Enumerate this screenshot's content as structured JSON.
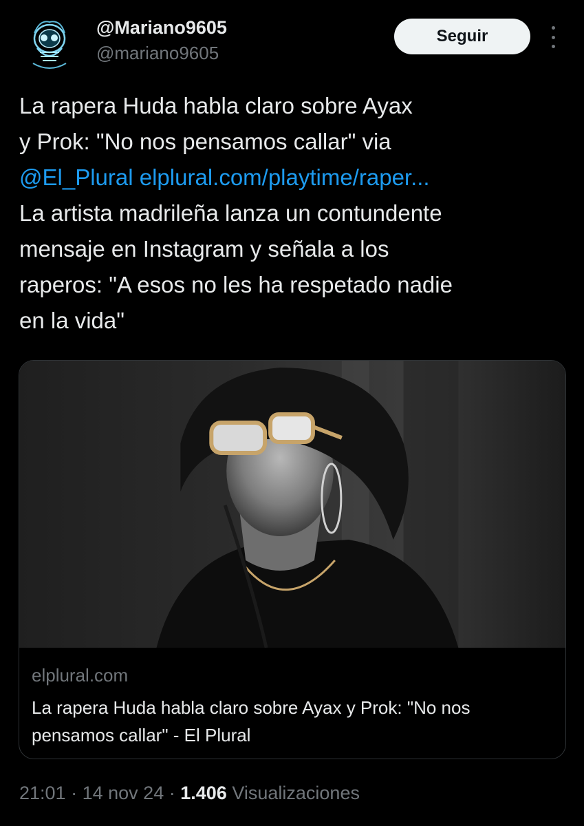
{
  "author": {
    "display_name": "@Mariano9605",
    "handle": "@mariano9605",
    "avatar_icon": "skull-avatar"
  },
  "actions": {
    "follow_label": "Seguir",
    "more_icon": "more-vertical-icon"
  },
  "tweet": {
    "lines": [
      "La rapera Huda habla claro sobre Ayax",
      "y Prok: \"No nos pensamos callar\" via",
      "La artista madrileña lanza un contundente",
      "mensaje en Instagram y señala a los",
      "raperos: \"A esos no les ha respetado nadie",
      "en la vida\""
    ],
    "mention": "@El_Plural",
    "url_text": "elplural.com/playtime/raper..."
  },
  "card": {
    "domain": "elplural.com",
    "title": "La rapera Huda habla claro sobre Ayax y Prok: \"No nos pensamos callar\" - El Plural"
  },
  "meta": {
    "time": "21:01",
    "date": "14 nov 24",
    "separator": "·",
    "views_count": "1.406",
    "views_label": "Visualizaciones"
  },
  "colors": {
    "background": "#000000",
    "text": "#e7e9ea",
    "muted": "#71767b",
    "link": "#1d9bf0",
    "button_bg": "#eff3f4"
  }
}
